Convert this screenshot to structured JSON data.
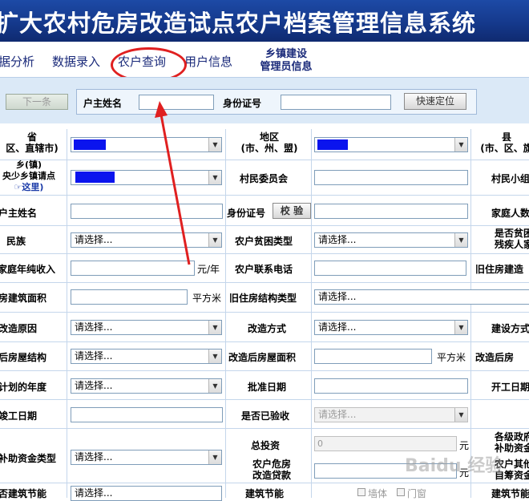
{
  "banner": {
    "title": "扩大农村危房改造试点农户档案管理信息系统"
  },
  "nav": {
    "items": [
      "据分析",
      "数据录入",
      "农户查询",
      "用户信息"
    ],
    "town_admin": [
      "乡镇建设",
      "管理员信息"
    ]
  },
  "search": {
    "prev_button": "下一条",
    "owner_label": "户主姓名",
    "id_label": "身份证号",
    "locate_button": "快速定位"
  },
  "form": {
    "province_label": [
      "省",
      "区、直辖市)"
    ],
    "region_label": [
      "地区",
      "(市、州、盟)"
    ],
    "county_label": [
      "县",
      "(市、区、旗"
    ],
    "town_label": [
      "乡(镇)",
      "央少乡镇请点",
      "☞这里)"
    ],
    "committee_label": "村民委员会",
    "group_label": "村民小组",
    "owner_label": "户主姓名",
    "id_label": "身份证号",
    "verify_button": "校 验",
    "family_label": "家庭人数",
    "ethnic_label": "民族",
    "poverty_type_label": "农户贫困类型",
    "disabled_label": [
      "是否贫困",
      "残疾人家"
    ],
    "income_label": "家庭年纯收入",
    "income_unit": "元/年",
    "phone_label": "农户联系电话",
    "old_year_label": "旧住房建造",
    "area_label": "房建筑面积",
    "area_unit": "平方米",
    "structure_label": "旧住房结构类型",
    "reason_label": "改造原因",
    "method_label": "改造方式",
    "build_label": "建设方式",
    "new_structure_label": "后房屋结构",
    "new_area_label": "改造后房屋面积",
    "new_area_unit": "平方米",
    "new_house_label": "改造后房",
    "plan_year_label": "计划的年度",
    "approve_label": "批准日期",
    "start_label": "开工日期",
    "finish_label": "竣工日期",
    "accepted_label": "是否已验收",
    "subsidy_type_label": "补助资金类型",
    "total_label": "总投资",
    "total_value": "0",
    "total_unit": "元",
    "gov_subsidy_label": [
      "各级政府",
      "补助资金"
    ],
    "loan_label": [
      "农户危房",
      "改造贷款"
    ],
    "loan_unit": "元",
    "other_label": [
      "农户其他",
      "自筹资金"
    ],
    "energy_label": "否建筑节能",
    "energy_label2": "建筑节能",
    "energy_label3": "建筑节能",
    "wall_option": "墙体",
    "window_option": "门窗",
    "placeholder": "请选择..."
  },
  "watermark": "Baidu 经验",
  "colors": {
    "banner": "#15398c",
    "redaction": "#0a14ee",
    "annotation": "#e02020",
    "nav_text": "#1a2a7a"
  }
}
